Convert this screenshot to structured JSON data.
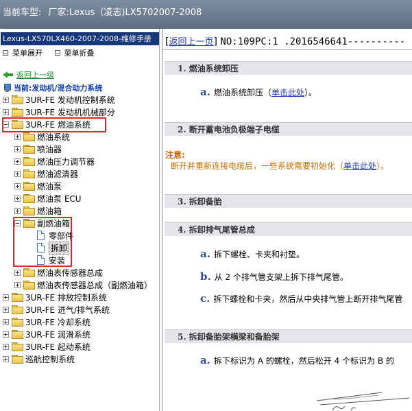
{
  "titlebar": {
    "label": "当前车型:",
    "vehicle": "厂家:Lexus（凌志)LX5702007-2008"
  },
  "left": {
    "manual_title": "Lexus-LX570LX460-2007-2008-维修手册",
    "toolbar": {
      "expand": "菜单展开",
      "collapse": "菜单折叠"
    },
    "back": "返回上一级",
    "current": "当前:发动机/混合动力系统",
    "tree": [
      {
        "id": "n1",
        "text": "3UR-FE 发动机控制系统",
        "type": "folder",
        "expanded": false
      },
      {
        "id": "n2",
        "text": "3UR-FE 发动机机械部分",
        "type": "folder",
        "expanded": false
      },
      {
        "id": "n3",
        "text": "3UR-FE 燃油系统",
        "type": "folder",
        "expanded": true
      },
      {
        "id": "n4",
        "text": "燃油系统",
        "type": "folder",
        "expanded": false
      },
      {
        "id": "n5",
        "text": "喷油器",
        "type": "folder",
        "expanded": false
      },
      {
        "id": "n6",
        "text": "燃油压力调节器",
        "type": "folder",
        "expanded": false
      },
      {
        "id": "n7",
        "text": "燃油滤清器",
        "type": "folder",
        "expanded": false
      },
      {
        "id": "n8",
        "text": "燃油泵",
        "type": "folder",
        "expanded": false
      },
      {
        "id": "n9",
        "text": "燃油泵 ECU",
        "type": "folder",
        "expanded": false
      },
      {
        "id": "n10",
        "text": "燃油箱",
        "type": "folder",
        "expanded": false
      },
      {
        "id": "n11",
        "text": "副燃油箱",
        "type": "folder",
        "expanded": true
      },
      {
        "id": "n12",
        "text": "零部件",
        "type": "doc"
      },
      {
        "id": "n13",
        "text": "拆卸",
        "type": "doc",
        "selected": true
      },
      {
        "id": "n14",
        "text": "安装",
        "type": "doc"
      },
      {
        "id": "n15",
        "text": "燃油表传感器总成",
        "type": "folder",
        "expanded": false
      },
      {
        "id": "n16",
        "text": "燃油表传感器总成（副燃油箱）",
        "type": "folder",
        "expanded": false
      },
      {
        "id": "n17",
        "text": "3UR-FE 排放控制系统",
        "type": "folder",
        "expanded": false
      },
      {
        "id": "n18",
        "text": "3UR-FE 进气/排气系统",
        "type": "folder",
        "expanded": false
      },
      {
        "id": "n19",
        "text": "3UR-FE 冷却系统",
        "type": "folder",
        "expanded": false
      },
      {
        "id": "n20",
        "text": "3UR-FE 润滑系统",
        "type": "folder",
        "expanded": false
      },
      {
        "id": "n21",
        "text": "3UR-FE 起动系统",
        "type": "folder",
        "expanded": false
      },
      {
        "id": "n22",
        "text": "巡航控制系统",
        "type": "folder",
        "expanded": false
      }
    ]
  },
  "right": {
    "back_link": "返回上一页",
    "doc_no": "NO:109PC:1 .2016546641----------",
    "sections": [
      {
        "id": "s1",
        "title": "1. 燃油系统卸压"
      },
      {
        "id": "s2",
        "title": "2. 断开蓄电池负极端子电缆"
      },
      {
        "id": "s3",
        "title": "3. 拆卸备胎"
      },
      {
        "id": "s4",
        "title": "4. 拆卸排气尾管总成"
      },
      {
        "id": "s5",
        "title": "5. 拆卸备胎架横梁和备胎架"
      }
    ],
    "steps": {
      "s1a": {
        "letter": "a.",
        "text": "燃油系统卸压（",
        "link": "单击此处",
        "tail": "）。"
      },
      "s4a": {
        "letter": "a.",
        "text": "拆下螺栓、卡夹和衬垫。"
      },
      "s4b": {
        "letter": "b.",
        "text": "从 2 个排气管支架上拆下排气尾管。"
      },
      "s4c": {
        "letter": "c.",
        "text": "拆下螺栓和卡夹，然后从中央排气管上断开排气尾管"
      },
      "s5a": {
        "letter": "a.",
        "text": "拆下标识为 A 的螺栓，然后松开 4 个标识为 B 的"
      }
    },
    "note": {
      "title": "注意:",
      "text": "断开并重新连接电缆后，一些系统需要初始化（",
      "link": "单击此处",
      "tail": "）。"
    }
  },
  "colors": {
    "titlebar": "#6b7c8f",
    "manual_title_bg": "#16377c",
    "highlight_box": "#d42a2a",
    "note_text": "#c46d00",
    "link": "#1a35b5"
  }
}
